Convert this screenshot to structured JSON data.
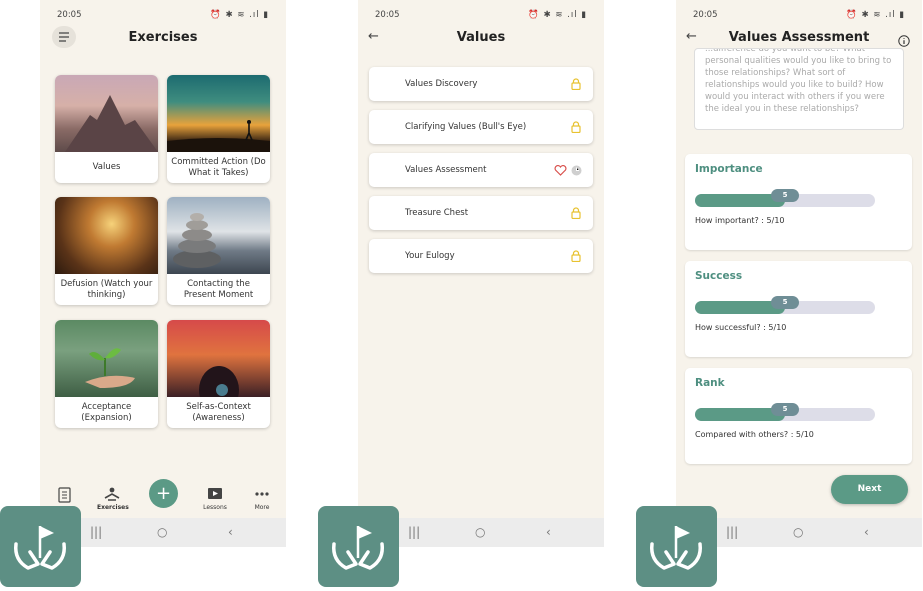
{
  "status_bar": {
    "time": "20:05",
    "icons": "⏰ ✱ ≋ .ıl ▮"
  },
  "screen1": {
    "title": "Exercises",
    "cards": [
      {
        "label": "Values"
      },
      {
        "label": "Committed Action (Do What it Takes)"
      },
      {
        "label": "Defusion (Watch your thinking)"
      },
      {
        "label": "Contacting the Present Moment"
      },
      {
        "label": "Acceptance (Expansion)"
      },
      {
        "label": "Self-as-Context (Awareness)"
      }
    ],
    "nav": {
      "journal": "",
      "exercises": "Exercises",
      "lessons": "Lessons",
      "more": "More"
    }
  },
  "screen2": {
    "title": "Values",
    "items": [
      {
        "label": "Values Discovery"
      },
      {
        "label": "Clarifying Values (Bull's Eye)"
      },
      {
        "label": "Values Assessment"
      },
      {
        "label": "Treasure Chest"
      },
      {
        "label": "Your Eulogy"
      }
    ]
  },
  "screen3": {
    "title": "Values Assessment",
    "question_text": "...difference do you want to be? What personal qualities would you like to bring to those relationships? What sort of relationships would you like to build? How would you interact with others if you were the ideal you in these relationships?",
    "sliders": [
      {
        "heading": "Importance",
        "value": "5",
        "caption": "How important? : 5/10",
        "fraction": 0.5
      },
      {
        "heading": "Success",
        "value": "5",
        "caption": "How successful? : 5/10",
        "fraction": 0.5
      },
      {
        "heading": "Rank",
        "value": "5",
        "caption": "Compared with others? : 5/10",
        "fraction": 0.5
      }
    ],
    "next_label": "Next"
  },
  "colors": {
    "accent": "#5b9a86",
    "background": "#f7f3eb",
    "lock": "#e8c230",
    "heart": "#d9534f"
  }
}
